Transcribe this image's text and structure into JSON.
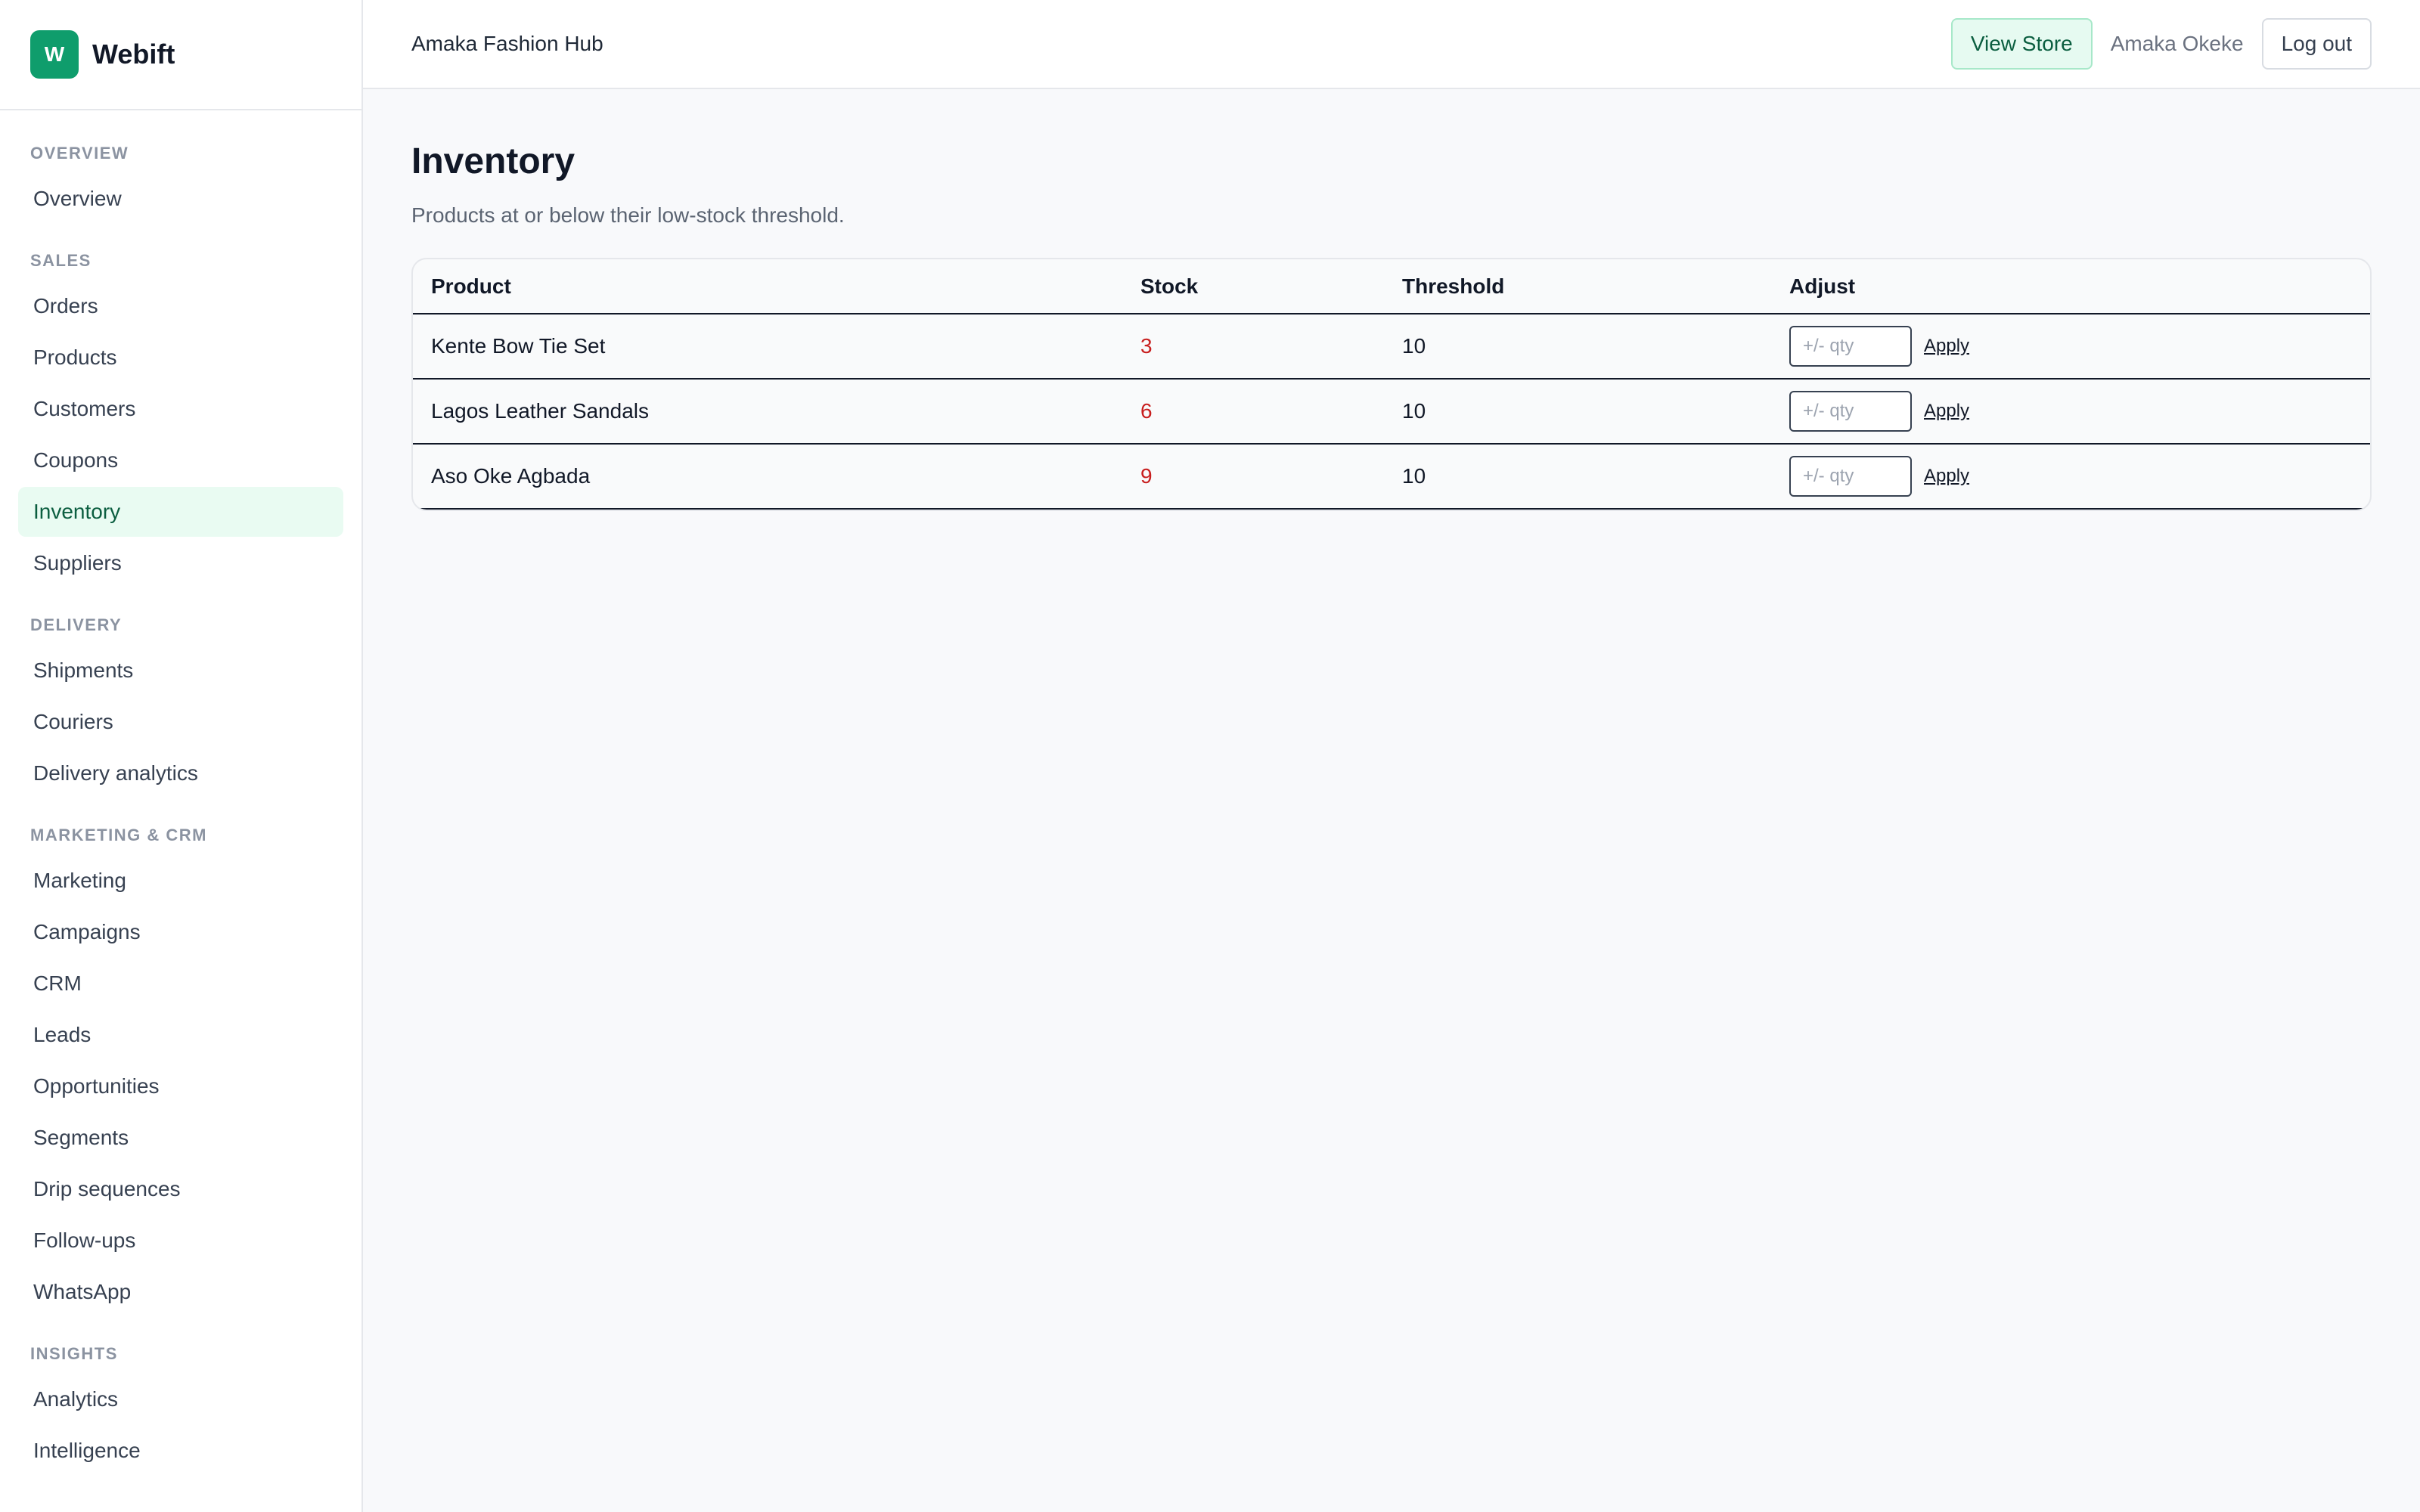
{
  "brand": {
    "logo_letter": "W",
    "name": "Webift",
    "color": "#0f9d6c"
  },
  "sidebar": {
    "sections": [
      {
        "heading": "OVERVIEW",
        "items": [
          "Overview"
        ]
      },
      {
        "heading": "SALES",
        "items": [
          "Orders",
          "Products",
          "Customers",
          "Coupons",
          "Inventory",
          "Suppliers"
        ]
      },
      {
        "heading": "DELIVERY",
        "items": [
          "Shipments",
          "Couriers",
          "Delivery analytics"
        ]
      },
      {
        "heading": "MARKETING & CRM",
        "items": [
          "Marketing",
          "Campaigns",
          "CRM",
          "Leads",
          "Opportunities",
          "Segments",
          "Drip sequences",
          "Follow-ups",
          "WhatsApp"
        ]
      },
      {
        "heading": "INSIGHTS",
        "items": [
          "Analytics",
          "Intelligence"
        ]
      }
    ],
    "active_item": "Inventory"
  },
  "header": {
    "store_name": "Amaka Fashion Hub",
    "view_store_label": "View Store",
    "user_name": "Amaka Okeke",
    "logout_label": "Log out"
  },
  "main": {
    "title": "Inventory",
    "subtitle": "Products at or below their low-stock threshold.",
    "table": {
      "columns": [
        "Product",
        "Stock",
        "Threshold",
        "Adjust"
      ],
      "rows": [
        {
          "product": "Kente Bow Tie Set",
          "stock": "3",
          "threshold": "10"
        },
        {
          "product": "Lagos Leather Sandals",
          "stock": "6",
          "threshold": "10"
        },
        {
          "product": "Aso Oke Agbada",
          "stock": "9",
          "threshold": "10"
        }
      ],
      "qty_placeholder": "+/- qty",
      "apply_label": "Apply"
    }
  }
}
